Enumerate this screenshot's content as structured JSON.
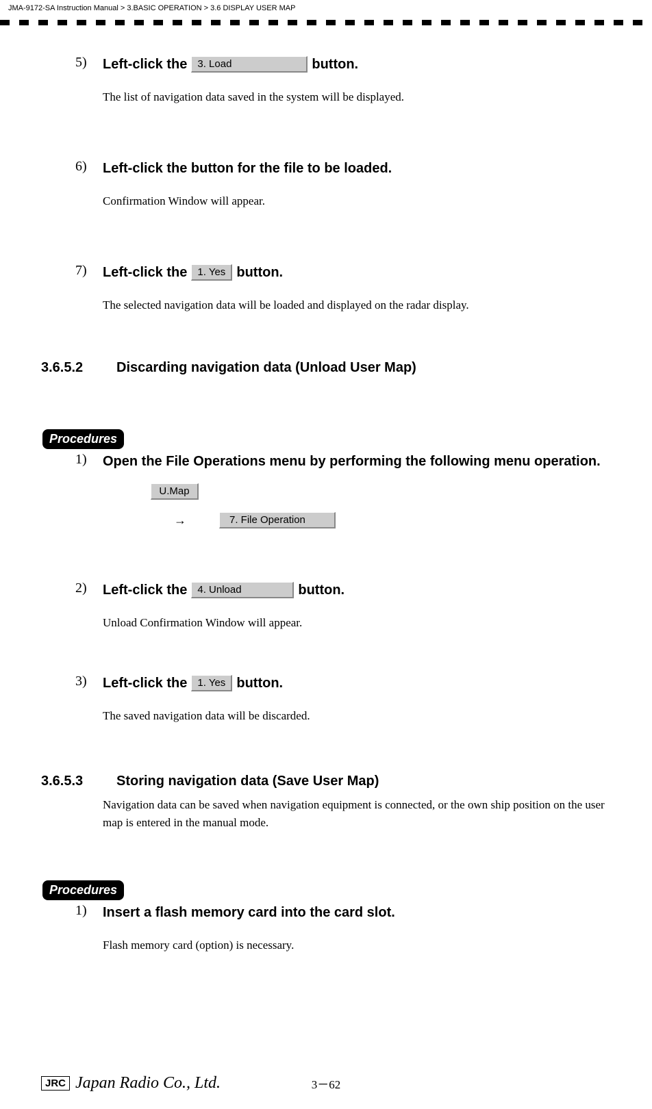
{
  "header": {
    "path_manual": "JMA-9172-SA Instruction Manual",
    "sep": " > ",
    "path_ch": "3.BASIC OPERATION",
    "path_sec": "3.6  DISPLAY USER MAP"
  },
  "steps": {
    "s5": {
      "num": "5)",
      "pre": "Left-click the ",
      "btn": "3. Load",
      "post": " button.",
      "desc": "The list of navigation data saved in the system will be displayed."
    },
    "s6": {
      "num": "6)",
      "title": "Left-click the button for the file to be loaded.",
      "desc": "Confirmation Window will appear."
    },
    "s7": {
      "num": "7)",
      "pre": "Left-click the ",
      "btn": "1. Yes",
      "post": " button.",
      "desc": "The selected navigation data will be loaded and displayed on the radar display."
    }
  },
  "sec3652": {
    "num": "3.6.5.2",
    "title": "Discarding navigation data (Unload User Map)"
  },
  "procedures_label": "Procedures",
  "proc1": {
    "s1": {
      "num": "1)",
      "title": "Open the File Operations menu by performing the following menu operation.",
      "umap": "U.Map",
      "arrow": "→",
      "fileop": "7. File Operation"
    },
    "s2": {
      "num": "2)",
      "pre": "Left-click the ",
      "btn": "4. Unload",
      "post": " button.",
      "desc": "Unload Confirmation Window will appear."
    },
    "s3": {
      "num": "3)",
      "pre": " Left-click the ",
      "btn": "1. Yes",
      "post": " button.",
      "desc": "The saved navigation data will be discarded."
    }
  },
  "sec3653": {
    "num": "3.6.5.3",
    "title": "Storing navigation data (Save User Map)",
    "body": "Navigation data can be saved when navigation equipment is connected, or the own ship position on the user map is entered in the manual mode."
  },
  "proc2": {
    "s1": {
      "num": "1)",
      "title": "Insert a flash memory card into the card slot.",
      "desc": "Flash memory card (option) is necessary."
    }
  },
  "footer": {
    "jrc": "JRC",
    "company": "Japan Radio Co., Ltd.",
    "page": "3－62"
  }
}
